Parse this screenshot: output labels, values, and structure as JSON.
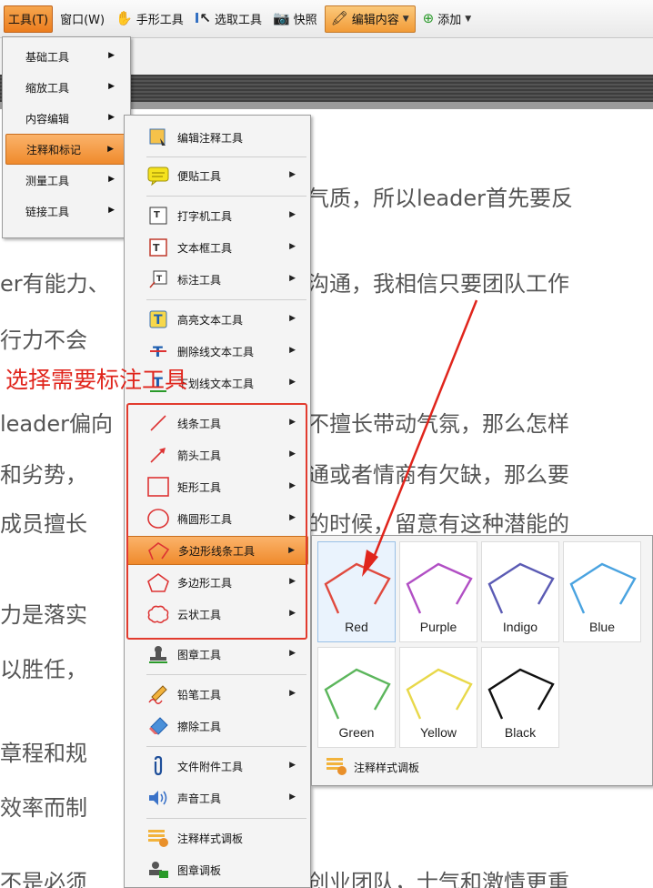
{
  "toolbar": {
    "tools_menu": "工具(T)",
    "window_menu": "窗口(W)",
    "hand_tool": "手形工具",
    "select_tool": "选取工具",
    "snapshot": "快照",
    "edit_content": "编辑内容",
    "add": "添加"
  },
  "tools_menu_items": [
    {
      "label": "基础工具"
    },
    {
      "label": "缩放工具"
    },
    {
      "label": "内容编辑"
    },
    {
      "label": "注释和标记"
    },
    {
      "label": "测量工具"
    },
    {
      "label": "链接工具"
    }
  ],
  "annotation_menu_items": [
    {
      "label": "编辑注释工具"
    },
    {
      "label": "便贴工具"
    },
    {
      "label": "打字机工具"
    },
    {
      "label": "文本框工具"
    },
    {
      "label": "标注工具"
    },
    {
      "label": "高亮文本工具"
    },
    {
      "label": "删除线文本工具"
    },
    {
      "label": "下划线文本工具"
    },
    {
      "label": "线条工具"
    },
    {
      "label": "箭头工具"
    },
    {
      "label": "矩形工具"
    },
    {
      "label": "椭圆形工具"
    },
    {
      "label": "多边形线条工具"
    },
    {
      "label": "多边形工具"
    },
    {
      "label": "云状工具"
    },
    {
      "label": "图章工具"
    },
    {
      "label": "铅笔工具"
    },
    {
      "label": "擦除工具"
    },
    {
      "label": "文件附件工具"
    },
    {
      "label": "声音工具"
    },
    {
      "label": "注释样式调板"
    },
    {
      "label": "图章调板"
    }
  ],
  "color_submenu": {
    "swatches": [
      {
        "label": "Red",
        "color": "#e04a3f"
      },
      {
        "label": "Purple",
        "color": "#b14fc4"
      },
      {
        "label": "Indigo",
        "color": "#5b5bb4"
      },
      {
        "label": "Blue",
        "color": "#4aa3e0"
      },
      {
        "label": "Green",
        "color": "#5cb65c"
      },
      {
        "label": "Yellow",
        "color": "#e8d84a"
      },
      {
        "label": "Black",
        "color": "#111111"
      }
    ],
    "palette_label": "注释样式调板"
  },
  "annotation_text": "选择需要标注工具",
  "document_lines": [
    "气质，所以leader首先要反",
    "er有能力、",
    "沟通，我相信只要团队工作",
    "行力不会",
    "leader偏向",
    "不擅长带动气氛，那么怎样",
    "和劣势，",
    "通或者情商有欠缺，那么要",
    "成员擅长",
    "的时候，留意有这种潜能的",
    "力是落实",
    "以胜任，",
    "章程和规",
    "效率而制",
    "不是必须",
    "创业团队，士气和激情更重"
  ]
}
